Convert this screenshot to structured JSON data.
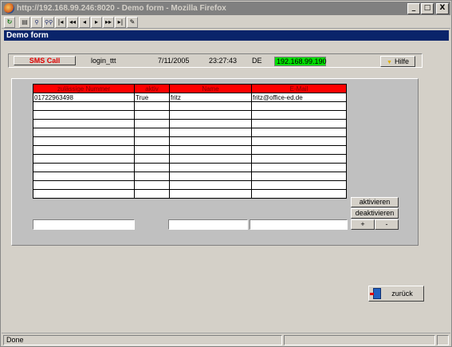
{
  "window": {
    "title": "http://192.168.99.246:8020 - Demo form - Mozilla Firefox",
    "minimize": "_",
    "maximize": "□",
    "close": "X"
  },
  "toolbar": {
    "buttons": [
      "reload",
      "print",
      "find",
      "find-next",
      "first",
      "previous-fast",
      "previous",
      "next",
      "next-fast",
      "last",
      "edit"
    ]
  },
  "form": {
    "title": "Demo form"
  },
  "info": {
    "sms_button": "SMS Call",
    "user": "login_ttt",
    "date": "7/11/2005",
    "time": "23:27:43",
    "lang": "DE",
    "ip": "192.168.99.190",
    "help_button": "Hilfe"
  },
  "table": {
    "headers": [
      "zulässige Nummer",
      "aktiv",
      "Name",
      "E-Mail"
    ],
    "rows": [
      [
        "01722963498",
        "True",
        "fritz",
        "fritz@office-ed.de"
      ],
      [
        "",
        "",
        "",
        ""
      ],
      [
        "",
        "",
        "",
        ""
      ],
      [
        "",
        "",
        "",
        ""
      ],
      [
        "",
        "",
        "",
        ""
      ],
      [
        "",
        "",
        "",
        ""
      ],
      [
        "",
        "",
        "",
        ""
      ],
      [
        "",
        "",
        "",
        ""
      ],
      [
        "",
        "",
        "",
        ""
      ],
      [
        "",
        "",
        "",
        ""
      ],
      [
        "",
        "",
        "",
        ""
      ],
      [
        "",
        "",
        "",
        ""
      ]
    ]
  },
  "actions": {
    "activate": "aktivieren",
    "deactivate": "deaktivieren",
    "plus": "+",
    "minus": "-"
  },
  "nav": {
    "back": "zurück"
  },
  "status": {
    "text": "Done"
  },
  "colors": {
    "header_bg": "#ff0000",
    "ip_bg": "#00e000",
    "sms_text": "#e00000",
    "form_title_bg": "#0a246a"
  }
}
